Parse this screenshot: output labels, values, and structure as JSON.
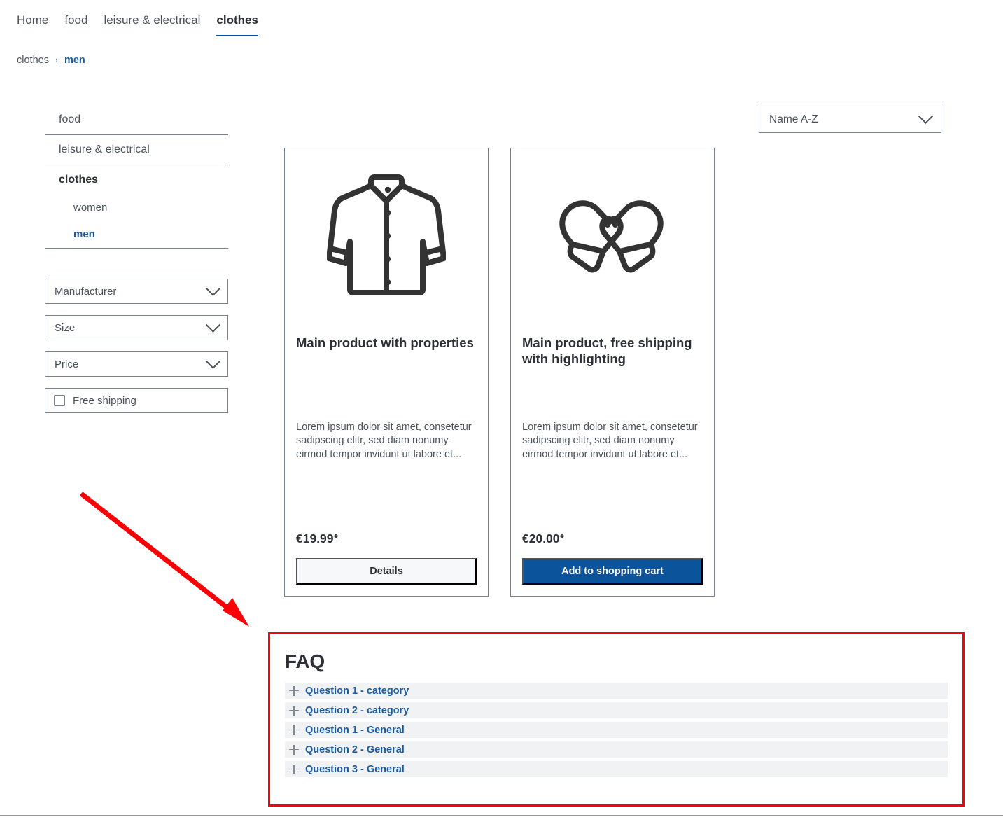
{
  "topnav": {
    "items": [
      {
        "label": "Home",
        "active": false
      },
      {
        "label": "food",
        "active": false
      },
      {
        "label": "leisure & electrical",
        "active": false
      },
      {
        "label": "clothes",
        "active": true
      }
    ]
  },
  "breadcrumb": {
    "parent": "clothes",
    "separator": "›",
    "current": "men"
  },
  "sidebar": {
    "categories": [
      {
        "label": "food",
        "style": "normal"
      },
      {
        "label": "leisure & electrical",
        "style": "normal"
      },
      {
        "label": "clothes",
        "style": "bold"
      },
      {
        "label": "women",
        "style": "sub"
      },
      {
        "label": "men",
        "style": "sub-active"
      }
    ],
    "filters": [
      {
        "label": "Manufacturer",
        "type": "dropdown"
      },
      {
        "label": "Size",
        "type": "dropdown"
      },
      {
        "label": "Price",
        "type": "dropdown"
      }
    ],
    "free_shipping": {
      "label": "Free shipping",
      "checked": false
    }
  },
  "sort": {
    "value": "Name A-Z"
  },
  "products": [
    {
      "icon": "shirt-icon",
      "title": "Main product with properties",
      "description": "Lorem ipsum dolor sit amet, consetetur sadipscing elitr, sed diam nonumy eirmod tempor invidunt ut labore et...",
      "price": "€19.99*",
      "button_label": "Details",
      "button_style": "secondary"
    },
    {
      "icon": "mittens-icon",
      "title": "Main product, free shipping with highlighting",
      "description": "Lorem ipsum dolor sit amet, consetetur sadipscing elitr, sed diam nonumy eirmod tempor invidunt ut labore et...",
      "price": "€20.00*",
      "button_label": "Add to shopping cart",
      "button_style": "primary"
    }
  ],
  "faq": {
    "title": "FAQ",
    "items": [
      {
        "label": "Question 1 - category"
      },
      {
        "label": "Question 2 - category"
      },
      {
        "label": "Question 1 - General"
      },
      {
        "label": "Question 2 - General"
      },
      {
        "label": "Question 3 - General"
      }
    ]
  },
  "annotations": {
    "arrow_color": "#fb0005",
    "highlight_box_color": "#fb0005"
  },
  "colors": {
    "accent_blue": "#0b539b",
    "link_blue": "#1b5a9e",
    "text_dark": "#2b3136",
    "text_body": "#4a545b",
    "border_gray": "#798490",
    "faq_row_bg": "#f1f2f3"
  }
}
